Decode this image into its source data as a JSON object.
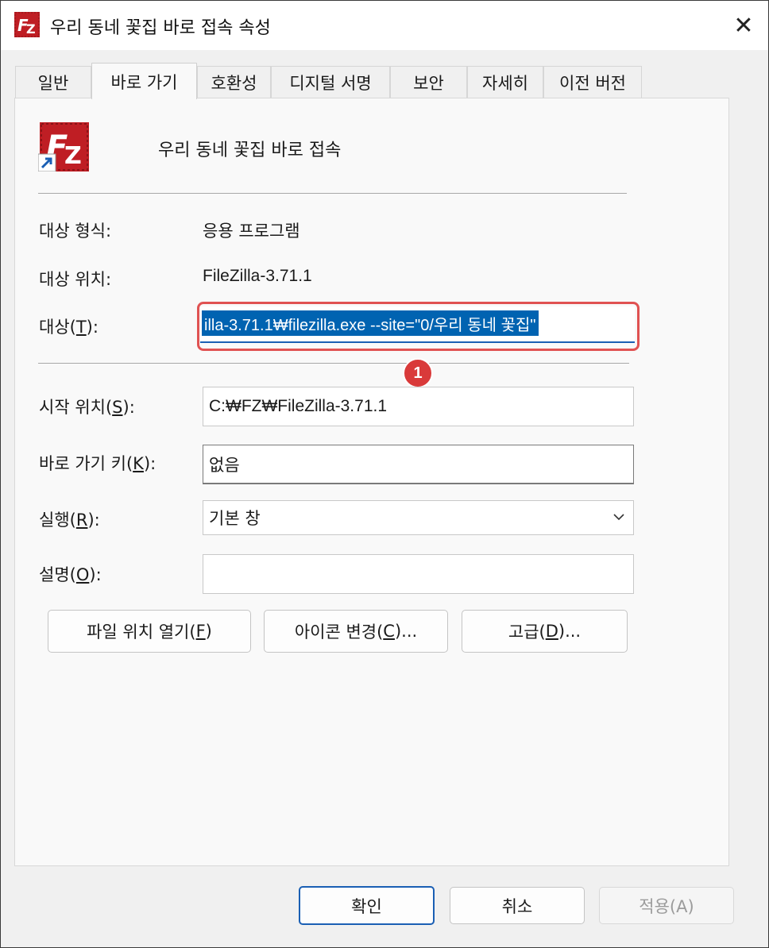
{
  "window": {
    "title": "우리 동네 꽃집 바로 접속 속성",
    "close_glyph": "✕"
  },
  "tabs": [
    {
      "label": "일반",
      "active": false
    },
    {
      "label": "바로 가기",
      "active": true
    },
    {
      "label": "호환성",
      "active": false
    },
    {
      "label": "디지털 서명",
      "active": false
    },
    {
      "label": "보안",
      "active": false
    },
    {
      "label": "자세히",
      "active": false
    },
    {
      "label": "이전 버전",
      "active": false
    }
  ],
  "shortcut": {
    "name": "우리 동네 꽃집 바로 접속",
    "icon": "filezilla-shortcut-icon"
  },
  "fields": {
    "target_type_label": "대상 형식:",
    "target_type_value": "응용 프로그램",
    "target_location_label": "대상 위치:",
    "target_location_value": "FileZilla-3.71.1",
    "target_label_pre": "대상(",
    "target_label_key": "T",
    "target_label_post": "):",
    "target_value": "illa-3.71.1₩filezilla.exe --site=\"0/우리 동네 꽃집\"",
    "start_in_label_pre": "시작 위치(",
    "start_in_label_key": "S",
    "start_in_label_post": "):",
    "start_in_value": "C:₩FZ₩FileZilla-3.71.1",
    "shortcut_key_label_pre": "바로 가기 키(",
    "shortcut_key_label_key": "K",
    "shortcut_key_label_post": "):",
    "shortcut_key_value": "없음",
    "run_label_pre": "실행(",
    "run_label_key": "R",
    "run_label_post": "):",
    "run_value": "기본 창",
    "comment_label_pre": "설명(",
    "comment_label_key": "O",
    "comment_label_post": "):",
    "comment_value": ""
  },
  "annotation": {
    "badge": "1",
    "highlight_color": "#e05252"
  },
  "action_buttons": {
    "open_location_pre": "파일 위치 열기(",
    "open_location_key": "F",
    "open_location_post": ")",
    "change_icon_pre": "아이콘 변경(",
    "change_icon_key": "C",
    "change_icon_post": ")...",
    "advanced_pre": "고급(",
    "advanced_key": "D",
    "advanced_post": ")..."
  },
  "dialog_buttons": {
    "ok": "확인",
    "cancel": "취소",
    "apply": "적용(A)"
  },
  "colors": {
    "accent": "#1a5fb4",
    "selection": "#0063b1",
    "filezilla_red": "#bf1e24"
  }
}
